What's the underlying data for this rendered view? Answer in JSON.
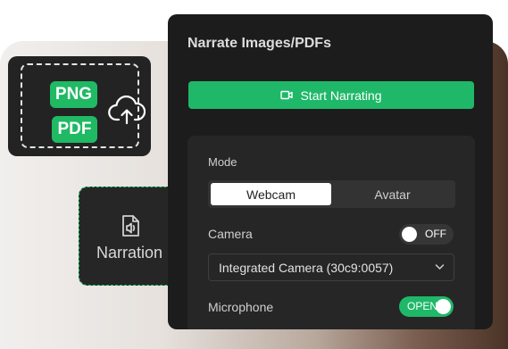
{
  "upload_card": {
    "png_label": "PNG",
    "pdf_label": "PDF",
    "upload_icon": "cloud-upload-icon"
  },
  "narration_card": {
    "label": "Narration",
    "icon": "audio-document-icon"
  },
  "panel": {
    "title": "Narrate Images/PDFs",
    "start_button": {
      "label": "Start Narrating",
      "icon": "video-camera-icon"
    },
    "mode": {
      "label": "Mode",
      "options": [
        "Webcam",
        "Avatar"
      ],
      "selected": "Webcam"
    },
    "camera": {
      "label": "Camera",
      "toggle": "OFF",
      "select_value": "Integrated Camera (30c9:0057)",
      "select_icon": "chevron-down-icon"
    },
    "microphone": {
      "label": "Microphone",
      "toggle": "OPEN"
    }
  },
  "colors": {
    "accent_green": "#1fb868",
    "panel_bg": "#1c1c1c",
    "settings_bg": "#262626"
  }
}
